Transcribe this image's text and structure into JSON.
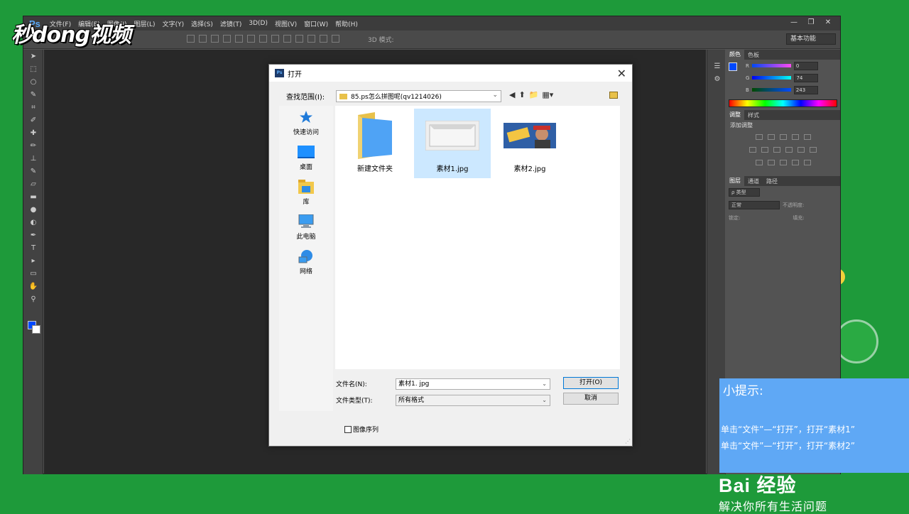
{
  "watermark": "秒dong视频",
  "ps": {
    "logo": "Ps",
    "menu": [
      "文件(F)",
      "编辑(E)",
      "图像(I)",
      "图层(L)",
      "文字(Y)",
      "选择(S)",
      "滤镜(T)",
      "3D(D)",
      "视图(V)",
      "窗口(W)",
      "帮助(H)"
    ],
    "window_controls": [
      "—",
      "❐",
      "✕"
    ],
    "options_label": "3D 模式:",
    "workspace": "基本功能"
  },
  "panels": {
    "color_tabs": [
      "颜色",
      "色板"
    ],
    "color": {
      "fg": "#0049ff",
      "r_label": "R",
      "r_value": "0",
      "g_label": "G",
      "g_value": "74",
      "b_label": "B",
      "b_value": "243"
    },
    "adjust_tabs": [
      "调整",
      "样式"
    ],
    "adjust_label": "添加调整",
    "layers_tabs": [
      "图层",
      "通道",
      "路径"
    ],
    "layers_kind": "ρ 类型",
    "blend_mode": "正常",
    "opacity_label": "不透明度:",
    "lock_label": "锁定:",
    "fill_label": "填充:"
  },
  "dialog": {
    "title": "打开",
    "lookin_label": "查找范围(I):",
    "lookin_value": "85.ps怎么拼图呢(qv1214026)",
    "places": [
      {
        "label": "快速访问",
        "icon": "quick-access-icon"
      },
      {
        "label": "桌面",
        "icon": "desktop-icon"
      },
      {
        "label": "库",
        "icon": "library-icon"
      },
      {
        "label": "此电脑",
        "icon": "this-pc-icon"
      },
      {
        "label": "网络",
        "icon": "network-icon"
      }
    ],
    "files": [
      {
        "name": "新建文件夹",
        "type": "folder"
      },
      {
        "name": "素材1.jpg",
        "type": "image",
        "selected": true
      },
      {
        "name": "素材2.jpg",
        "type": "image"
      }
    ],
    "filename_label": "文件名(N):",
    "filename_value": "素材1. jpg",
    "filetype_label": "文件类型(T):",
    "filetype_value": "所有格式",
    "open_button": "打开(O)",
    "cancel_button": "取消",
    "sequence_label": "图像序列"
  },
  "tip": {
    "title": "小提示:",
    "line1": "单击“文件”—“打开”，打开“素材1”",
    "line2": "单击“文件”—“打开”，打开“素材2”"
  },
  "baidu": {
    "logo": "Bai 经验",
    "slogan": "解决你所有生活问题"
  }
}
